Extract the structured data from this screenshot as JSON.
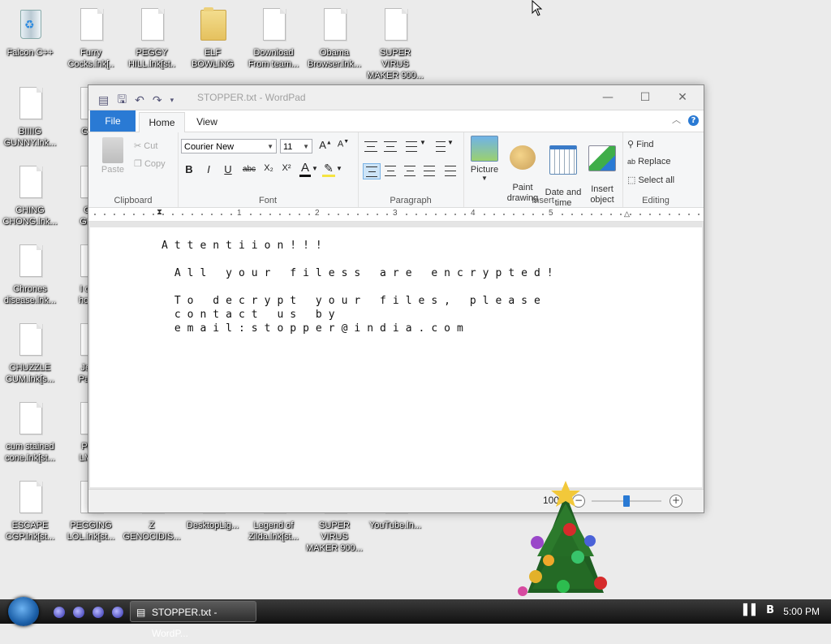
{
  "desktop": {
    "icons": [
      {
        "label": "Falcon C++",
        "type": "bin"
      },
      {
        "label": "Furry\nCocks.lnk[..",
        "type": "doc"
      },
      {
        "label": "PEGGY\nHILL.lnk[st..",
        "type": "doc"
      },
      {
        "label": "ELF\nBOWLING",
        "type": "folder"
      },
      {
        "label": "Download\nFrom team...",
        "type": "doc"
      },
      {
        "label": "Obama\nBrowser.lnk...",
        "type": "doc"
      },
      {
        "label": "SUPER VIRUS\nMAKER 900...",
        "type": "doc"
      },
      {
        "label": "BIIIIG\nGUNNY.lnk...",
        "type": "doc"
      },
      {
        "label": "Gem",
        "type": "doc"
      },
      {
        "label": "CHING\nCHONG.lnk...",
        "type": "doc"
      },
      {
        "label": "Get\nGreat",
        "type": "doc"
      },
      {
        "label": "Chrones\ndisease.lnk...",
        "type": "doc"
      },
      {
        "label": "I cant\nhow F",
        "type": "doc"
      },
      {
        "label": "CHUZZLE\nCUM.lnk[s...",
        "type": "doc"
      },
      {
        "label": "Jews\nPalest",
        "type": "doc"
      },
      {
        "label": "cum stained\ncone.lnk[st...",
        "type": "doc"
      },
      {
        "label": "PEG\nLMFA",
        "type": "doc"
      },
      {
        "label": "ESCAPE\nCGP.lnk[st...",
        "type": "doc"
      },
      {
        "label": "PEGGING\nLOL.lnk[st...",
        "type": "doc"
      },
      {
        "label": "Z\nGENOCIDIS...",
        "type": "doc"
      },
      {
        "label": "DesktopLig...",
        "type": "doc"
      },
      {
        "label": "Legend of\nZilda.lnk[st...",
        "type": "doc"
      },
      {
        "label": "SUPER VIRUS\nMAKER 900...",
        "type": "doc"
      },
      {
        "label": "YouTube.ln...",
        "type": "doc"
      }
    ]
  },
  "window": {
    "title": "STOPPER.txt - WordPad",
    "minimize": "—",
    "maximize": "☐",
    "close": "✕"
  },
  "ribbon": {
    "tabs": {
      "file": "File",
      "home": "Home",
      "view": "View"
    },
    "clipboard": {
      "paste": "Paste",
      "cut": "Cut",
      "copy": "Copy",
      "label": "Clipboard"
    },
    "font": {
      "family": "Courier New",
      "size": "11",
      "label": "Font",
      "bold": "B",
      "italic": "I",
      "underline": "U",
      "strike": "abc",
      "sub": "X₂",
      "sup": "X²",
      "color": "A"
    },
    "paragraph": {
      "label": "Paragraph"
    },
    "insert": {
      "picture": "Picture",
      "paint": "Paint\ndrawing",
      "datetime": "Date and\ntime",
      "object": "Insert\nobject",
      "label": "Insert"
    },
    "editing": {
      "find": "Find",
      "replace": "Replace",
      "select_all": "Select all",
      "label": "Editing"
    }
  },
  "ruler": {
    "marks": [
      "1",
      "2",
      "3",
      "4",
      "5"
    ]
  },
  "document": {
    "text": "Attentiion!!!\n\n All your filess are encrypted!\n\n To decrypt your files, please\n contact us by\n email:stopper@india.com"
  },
  "status": {
    "zoom": "100%",
    "zoom_fraction": 0.5
  },
  "taskbar": {
    "item_label": "STOPPER.txt - WordP...",
    "clock": "5:00 PM"
  },
  "colors": {
    "accent": "#2a7ad4",
    "desktop": "#ebebeb"
  }
}
